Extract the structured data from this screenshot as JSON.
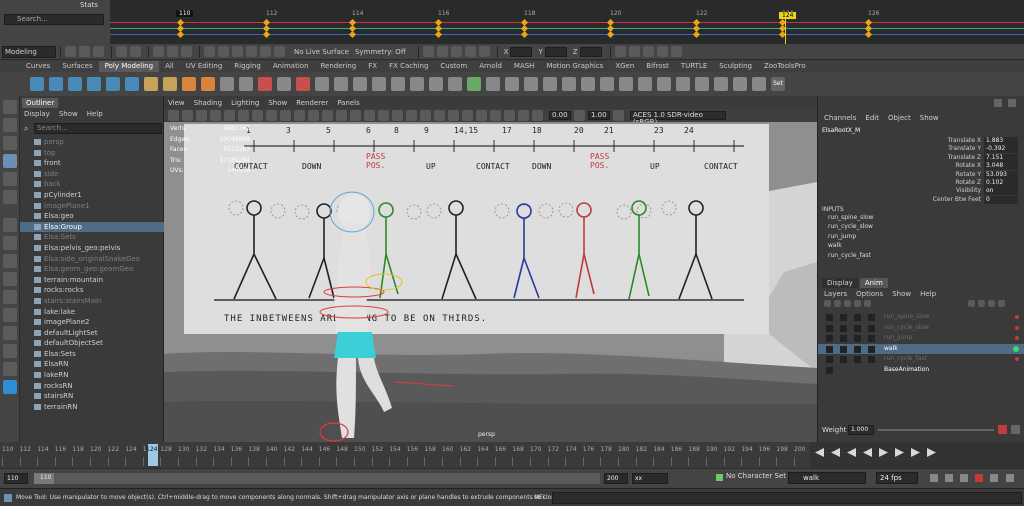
{
  "top": {
    "stats_label": "Stats",
    "search_placeholder": "Search...",
    "graph_ticks": [
      "110",
      "112",
      "114",
      "116",
      "118",
      "120",
      "122",
      "124",
      "126"
    ],
    "frame_marker": "110",
    "current_frame": "124"
  },
  "status_line": {
    "mode": "Modeling",
    "live_surface": "No Live Surface",
    "symmetry": "Symmetry: Off",
    "x": "X",
    "y": "Y",
    "z": "Z"
  },
  "shelf": {
    "tabs": [
      "Curves",
      "Surfaces",
      "Poly Modeling",
      "All",
      "UV Editing",
      "Rigging",
      "Animation",
      "Rendering",
      "FX",
      "FX Caching",
      "Custom",
      "Arnold",
      "MASH",
      "Motion Graphics",
      "XGen",
      "Bifrost",
      "TURTLE",
      "Sculpting",
      "ZooToolsPro"
    ],
    "active_tab": "Poly Modeling",
    "set_label": "Set"
  },
  "outliner": {
    "tab": "Outliner",
    "menu": [
      "Display",
      "Show",
      "Help"
    ],
    "search_placeholder": "Search...",
    "items": [
      {
        "label": "persp",
        "dim": true
      },
      {
        "label": "top",
        "dim": true
      },
      {
        "label": "front",
        "dim": false
      },
      {
        "label": "side",
        "dim": true
      },
      {
        "label": "back",
        "dim": true
      },
      {
        "label": "pCylinder1",
        "dim": false
      },
      {
        "label": "imagePlane1",
        "dim": true
      },
      {
        "label": "Elsa:geo",
        "dim": false
      },
      {
        "label": "Elsa:Group",
        "dim": false,
        "selected": true
      },
      {
        "label": "Elsa:Sets",
        "dim": true
      },
      {
        "label": "Elsa:pelvis_geo:pelvis",
        "dim": false
      },
      {
        "label": "Elsa:side_originalSnakeGeo",
        "dim": true
      },
      {
        "label": "Elsa:geom_geo:geomGeo",
        "dim": true
      },
      {
        "label": "terrain:mountain",
        "dim": false
      },
      {
        "label": "rocks:rocks",
        "dim": false
      },
      {
        "label": "stairs:stairsMain",
        "dim": true
      },
      {
        "label": "lake:lake",
        "dim": false
      },
      {
        "label": "imagePlane2",
        "dim": false
      },
      {
        "label": "defaultLightSet",
        "dim": false
      },
      {
        "label": "defaultObjectSet",
        "dim": false
      },
      {
        "label": "Elsa:Sets",
        "dim": false
      },
      {
        "label": "ElsaRN",
        "dim": false
      },
      {
        "label": "lakeRN",
        "dim": false
      },
      {
        "label": "rocksRN",
        "dim": false
      },
      {
        "label": "stairsRN",
        "dim": false
      },
      {
        "label": "terrainRN",
        "dim": false
      }
    ]
  },
  "viewport": {
    "menu": [
      "View",
      "Shading",
      "Lighting",
      "Show",
      "Renderer",
      "Panels"
    ],
    "exposure": "0.00",
    "gamma": "1.00",
    "colorspace": "ACES 1.0 SDR-video (sRGB)",
    "hud": [
      {
        "k": "Verts:",
        "v": "4681763"
      },
      {
        "k": "Edges:",
        "v": "10049689"
      },
      {
        "k": "Faces:",
        "v": "5572267"
      },
      {
        "k": "Tris:",
        "v": "17189284"
      },
      {
        "k": "UVs:",
        "v": "149578"
      }
    ],
    "camera_label": "persp",
    "sheet": {
      "numbers": [
        "1",
        "3",
        "5",
        "6",
        "8",
        "9",
        "14,15",
        "17",
        "18",
        "20",
        "21",
        "23",
        "24"
      ],
      "poses": [
        "CONTACT",
        "DOWN",
        "PASS POS.",
        "UP",
        "CONTACT",
        "DOWN",
        "PASS POS.",
        "UP",
        "CONTACT"
      ],
      "caption": "THE INBETWEENS ARE GOING TO BE ON THIRDS."
    }
  },
  "channel_box": {
    "menu": [
      "Channels",
      "Edit",
      "Object",
      "Show"
    ],
    "object": "ElsaRootX_M",
    "attributes": [
      {
        "name": "Translate X",
        "value": "1.883"
      },
      {
        "name": "Translate Y",
        "value": "-0.392"
      },
      {
        "name": "Translate Z",
        "value": "7.151"
      },
      {
        "name": "Rotate X",
        "value": "3.048"
      },
      {
        "name": "Rotate Y",
        "value": "53.093"
      },
      {
        "name": "Rotate Z",
        "value": "0.102"
      },
      {
        "name": "Visibility",
        "value": "on"
      },
      {
        "name": "Center Btw Feet",
        "value": "0"
      }
    ],
    "inputs_label": "INPUTS",
    "inputs": [
      "run_spine_slow",
      "run_cycle_slow",
      "run_jump",
      "walk",
      "run_cycle_fast"
    ]
  },
  "layers": {
    "tabs": [
      "Display",
      "Anim"
    ],
    "active_tab": "Anim",
    "menu": [
      "Layers",
      "Options",
      "Show",
      "Help"
    ],
    "rows": [
      {
        "name": "run_spine_slow",
        "state": "dim"
      },
      {
        "name": "run_cycle_slow",
        "state": "dim"
      },
      {
        "name": "run_jump",
        "state": "dim"
      },
      {
        "name": "walk",
        "state": "sel"
      },
      {
        "name": "run_cycle_fast",
        "state": "dim"
      },
      {
        "name": "BaseAnimation",
        "state": "base"
      }
    ],
    "weight_label": "Weight",
    "weight_value": "1.000"
  },
  "time_slider": {
    "ticks": [
      "110",
      "112",
      "114",
      "116",
      "118",
      "120",
      "122",
      "124",
      "126",
      "128",
      "130",
      "132",
      "134",
      "136",
      "138",
      "140",
      "142",
      "144",
      "146",
      "148",
      "150",
      "152",
      "154",
      "156",
      "158",
      "160",
      "162",
      "164",
      "166",
      "168",
      "170",
      "172",
      "174",
      "176",
      "178",
      "180",
      "182",
      "184",
      "186",
      "188",
      "190",
      "192",
      "194",
      "196",
      "198",
      "200"
    ],
    "current": "124"
  },
  "range_slider": {
    "start": "110",
    "inner_start": "110",
    "inner_end": "200",
    "end": "xx",
    "character_set": "No Character Set",
    "anim_layer": "walk",
    "fps": "24 fps"
  },
  "help_line": {
    "text": "Move Tool: Use manipulator to move object(s). Ctrl+middle-drag to move components along normals. Shift+drag manipulator axis or plane handles to extrude components or clone objects. Ctrl+Shift+drag to con",
    "mel": "MEL"
  }
}
